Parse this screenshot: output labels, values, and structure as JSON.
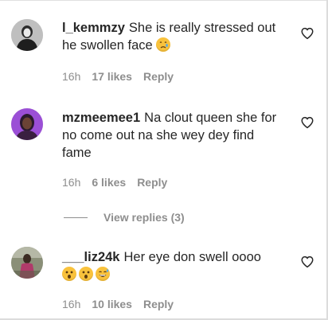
{
  "comments": [
    {
      "username": "l_kemmzy",
      "text_line1": "She is really stressed out",
      "text_line2": "he swollen face",
      "emoji": [
        "sad-tear-emoji"
      ],
      "time": "16h",
      "likes": "17 likes",
      "reply": "Reply"
    },
    {
      "username": "mzmeemee1",
      "text_line1": "Na clout queen she for",
      "text_line2": "no come out na she wey dey find",
      "text_line3": "fame",
      "time": "16h",
      "likes": "6 likes",
      "reply": "Reply"
    },
    {
      "username": "___liz24k",
      "text_line1": "Her eye don swell oooo",
      "emoji": [
        "astonished-emoji",
        "astonished-emoji",
        "grinning-sweat-emoji"
      ],
      "time": "16h",
      "likes": "10 likes",
      "reply": "Reply"
    }
  ],
  "view_replies": "View replies (3)",
  "icons": {
    "like": "heart-outline-icon"
  },
  "colors": {
    "text": "#262626",
    "secondary": "#8e8e8e",
    "emoji": "#f9c23c"
  }
}
